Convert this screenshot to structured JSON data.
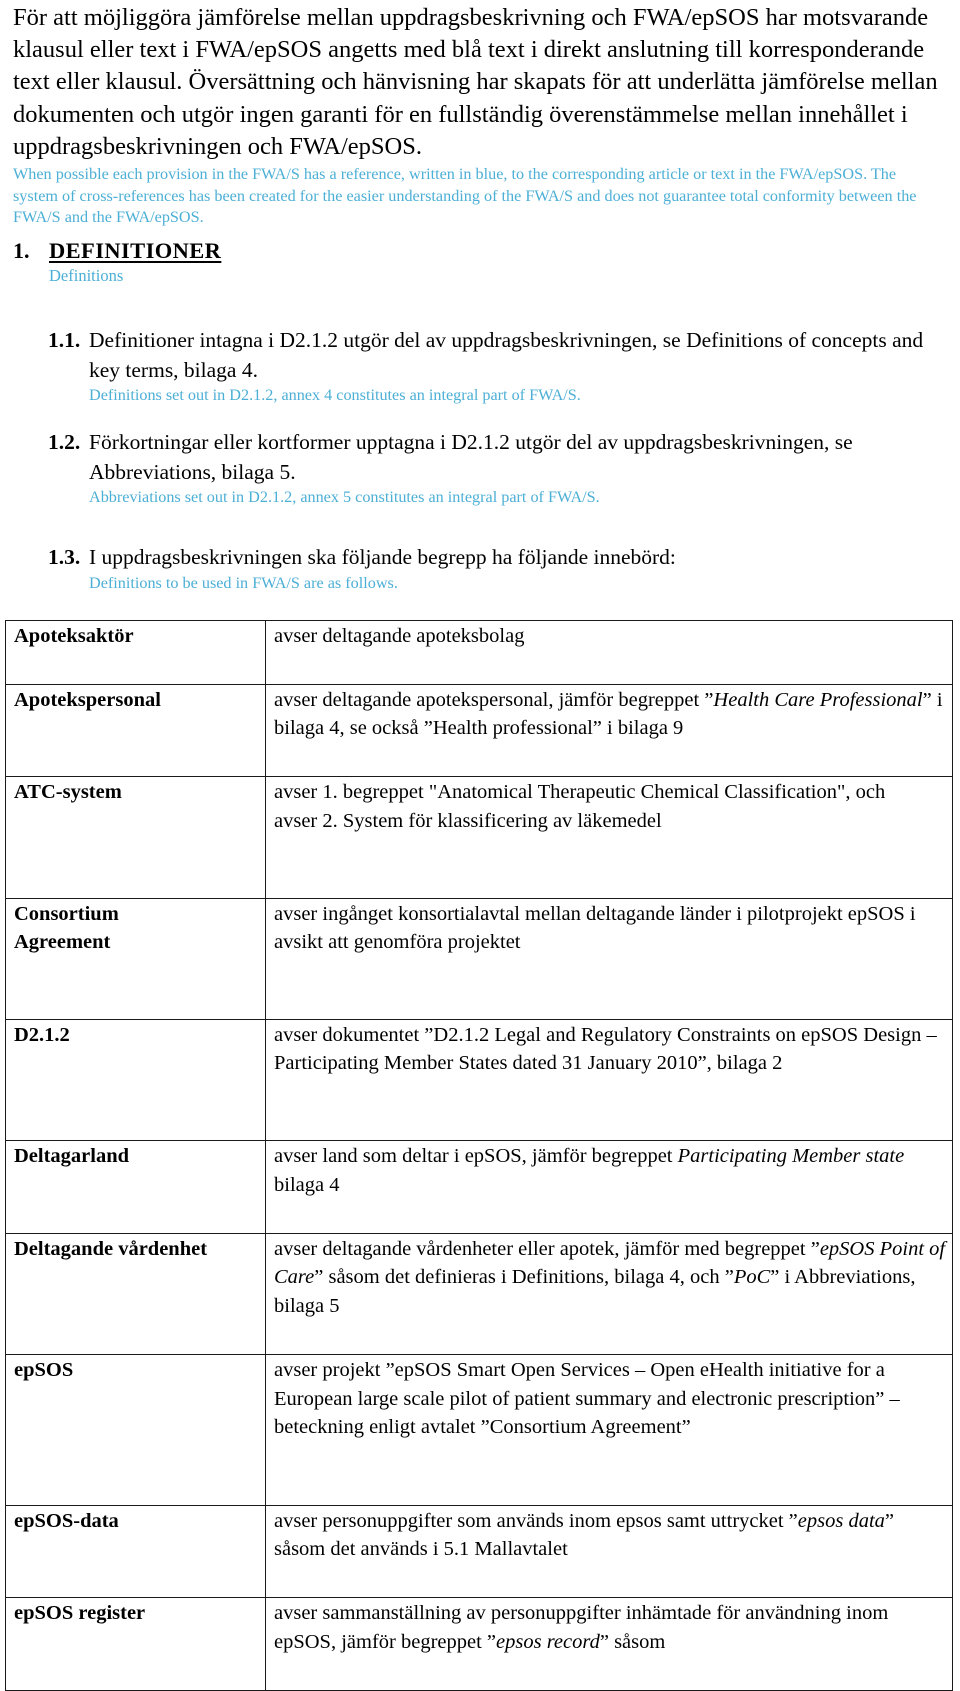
{
  "document": {
    "intro": {
      "swedish_html": "För att möjliggöra jämförelse mellan uppdragsbeskrivning och FWA/epSOS har motsvarande klausul eller text i FWA/epSOS angetts med blå text i direkt anslutning till korresponderande text eller klausul. Översättning och hänvisning har skapats för att underlätta jämförelse mellan dokumenten och utgör ingen garanti för en fullständig överenstämmelse mellan innehållet i uppdragsbeskrivningen och FWA/epSOS.",
      "english_html": "When possible each provision in the FWA/S has a reference, written in blue, to the corresponding article or text in the FWA/epSOS. The system of cross-references has been created for the easier understanding of the FWA/S and does not guarantee total conformity between the FWA/S and the FWA/epSOS."
    },
    "section": {
      "number": "1.",
      "title": "DEFINITIONER",
      "title_translation": "Definitions"
    },
    "clauses": [
      {
        "number": "1.1.",
        "text": "Definitioner intagna i D2.1.2 utgör del av uppdragsbeskrivningen, se Definitions of concepts and key terms, bilaga 4.",
        "translation": "Definitions set out in D2.1.2, annex 4 constitutes an integral part of FWA/S."
      },
      {
        "number": "1.2.",
        "text": "Förkortningar eller kortformer upptagna i D2.1.2 utgör del av uppdragsbeskrivningen, se Abbreviations, bilaga 5.",
        "translation": "Abbreviations set out in D2.1.2, annex 5 constitutes an integral part of FWA/S."
      },
      {
        "number": "1.3.",
        "text": "I uppdragsbeskrivningen ska följande begrepp ha följande innebörd:",
        "translation": "Definitions to be used in FWA/S are as follows."
      }
    ],
    "definitions_table": {
      "rows": [
        {
          "term": "Apoteksaktör",
          "definition_html": "avser deltagande apoteksbolag",
          "pad": "pad-1"
        },
        {
          "term": "Apotekspersonal",
          "definition_html": "avser deltagande apotekspersonal, jämför begreppet ”<i>Health Care Professional</i>” i bilaga 4, se också ”Health professional” i bilaga 9",
          "pad": "pad-2"
        },
        {
          "term": "ATC-system",
          "definition_html": "avser 1. begreppet \"Anatomical Therapeutic Chemical Classification\", och<br>avser 2. System för klassificering av läkemedel",
          "pad": "pad-3"
        },
        {
          "term": "Consortium Agreement",
          "term_html": "Consortium<br>Agreement",
          "definition_html": "avser ingånget konsortialavtal mellan deltagande länder i pilotprojekt epSOS i avsikt att genomföra projektet",
          "pad": "pad-2"
        },
        {
          "term": "D2.1.2",
          "definition_html": "avser dokumentet ”D2.1.2 Legal and Regulatory Constraints on epSOS Design – Participating Member States dated 31 January 2010”, bilaga 2",
          "pad": "pad-3"
        },
        {
          "term": "Deltagarland",
          "definition_html": "avser land som deltar i epSOS, jämför begreppet <i>Participating Member state</i> bilaga 4",
          "pad": "pad-2"
        },
        {
          "term": "Deltagande vårdenhet",
          "definition_html": "avser deltagande vårdenheter eller apotek, jämför med begreppet ”<i>epSOS Point of Care</i>” såsom det definieras i Definitions, bilaga 4, och ”<i>PoC</i>” i Abbreviations, bilaga 5",
          "pad": "pad-3"
        },
        {
          "term": "epSOS",
          "definition_html": "avser projekt ”epSOS Smart Open Services – Open eHealth initiative for a European large scale pilot of patient summary and electronic prescription” – beteckning enligt avtalet ”Consortium Agreement”",
          "pad": "pad-4"
        },
        {
          "term": "epSOS-data",
          "definition_html": "avser personuppgifter som används inom epsos samt uttrycket ”<i>epsos data</i>” såsom det används i 5.1 Mallavtalet",
          "pad": "pad-2"
        },
        {
          "term": "epSOS register",
          "definition_html": "avser sammanställning av personuppgifter inhämtade för användning inom epSOS, jämför begreppet ”<i>epsos record</i>” såsom",
          "pad": "pad-2"
        }
      ]
    },
    "colors": {
      "translation_blue": "#4CAFD6",
      "body_text": "#000000",
      "table_border": "#1a1a1a"
    }
  }
}
